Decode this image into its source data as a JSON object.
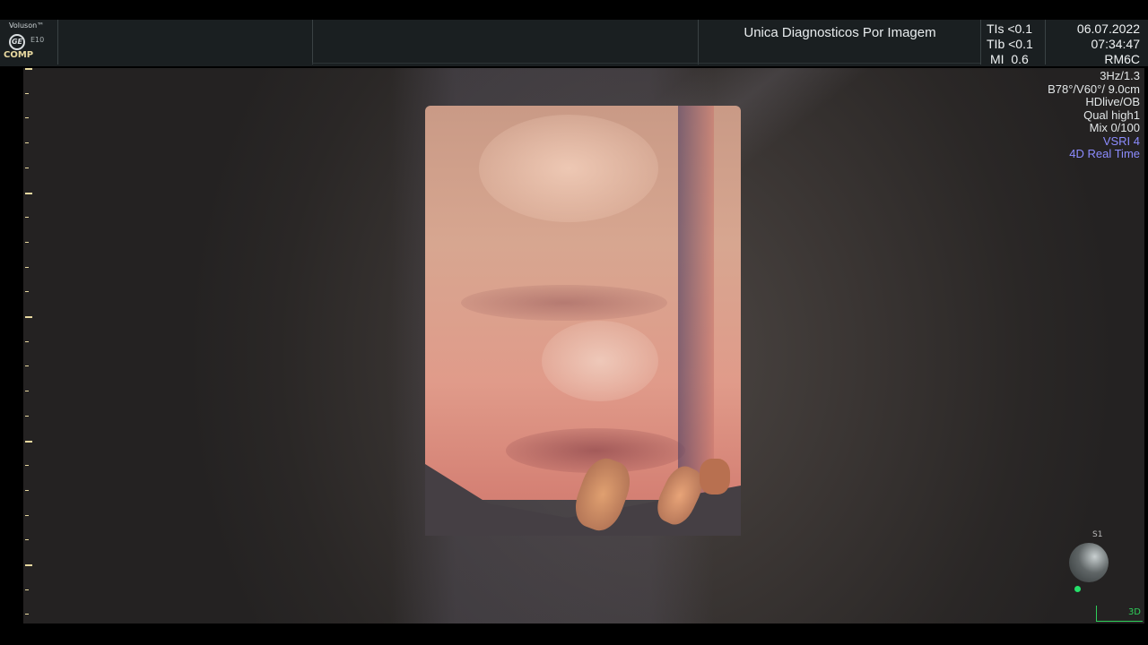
{
  "header": {
    "brand": "Voluson™",
    "logo_text": "GE",
    "model": "E10",
    "comp_label": "COMP",
    "clinic_name": "Unica Diagnosticos Por Imagem",
    "indices": {
      "tis_label": "TIs",
      "tis_value": "<0.1",
      "tib_label": "TIb",
      "tib_value": "<0.1",
      "mi_label": "MI",
      "mi_value": "0.6"
    },
    "date": "06.07.2022",
    "time": "07:34:47",
    "probe": "RM6C"
  },
  "params": {
    "frequency": "3Hz/1.3",
    "geometry": "B78°/V60°/ 9.0cm",
    "render_mode": "HDlive/OB",
    "quality": "Qual high1",
    "mix": "Mix 0/100",
    "vsri": "VSRI 4",
    "mode": "4D Real Time"
  },
  "orientation": {
    "label": "S1",
    "corner_label": "3D"
  },
  "colors": {
    "accent_blue": "#8c8cff",
    "scale_yellow": "#e8d9a0",
    "indicator_green": "#2ecf5a"
  }
}
